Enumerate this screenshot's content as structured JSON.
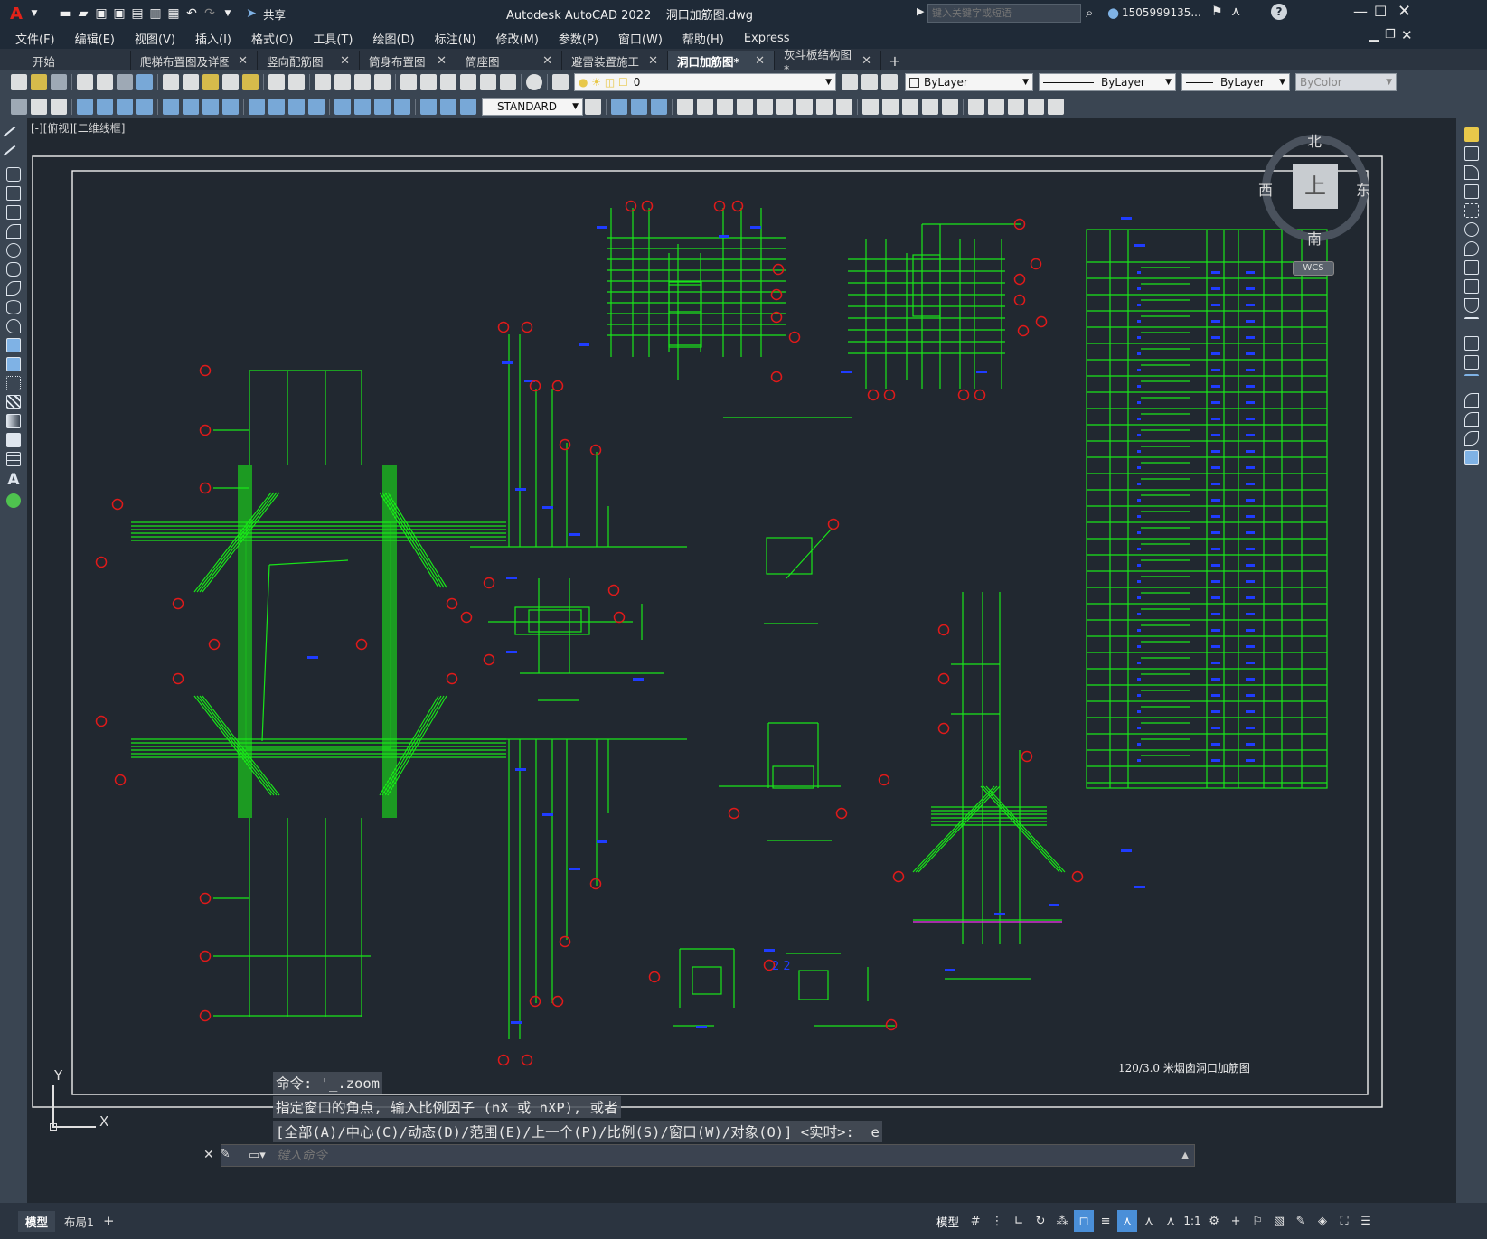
{
  "titlebar": {
    "app_logo": "A",
    "share_label": "共享",
    "title": "Autodesk AutoCAD 2022    洞口加筋图.dwg",
    "search_placeholder": "键入关键字或短语",
    "user": "1505999135...",
    "help": "?"
  },
  "menu": [
    "文件(F)",
    "编辑(E)",
    "视图(V)",
    "插入(I)",
    "格式(O)",
    "工具(T)",
    "绘图(D)",
    "标注(N)",
    "修改(M)",
    "参数(P)",
    "窗口(W)",
    "帮助(H)",
    "Express"
  ],
  "tabs": [
    {
      "label": "开始",
      "closable": false,
      "active": false
    },
    {
      "label": "爬梯布置图及详图一",
      "closable": true,
      "active": false
    },
    {
      "label": "竖向配筋图",
      "closable": true,
      "active": false
    },
    {
      "label": "筒身布置图",
      "closable": true,
      "active": false
    },
    {
      "label": "筒座图",
      "closable": true,
      "active": false
    },
    {
      "label": "避雷装置施工图",
      "closable": true,
      "active": false
    },
    {
      "label": "洞口加筋图*",
      "closable": true,
      "active": true
    },
    {
      "label": "灰斗板结构图*",
      "closable": true,
      "active": false
    }
  ],
  "toolbar": {
    "layer_value": "0",
    "color_value": "ByLayer",
    "linetype_value": "ByLayer",
    "lineweight_value": "ByLayer",
    "plotstyle_value": "ByColor",
    "textstyle_value": "STANDARD"
  },
  "viewport_label": "[-][俯视][二维线框]",
  "viewcube": {
    "north": "北",
    "south": "南",
    "east": "东",
    "west": "西",
    "top": "上",
    "wcs": "WCS"
  },
  "drawing": {
    "caption": "120/3.0 米烟囱洞口加筋图",
    "label_23": "2  2"
  },
  "ucs": {
    "x": "X",
    "y": "Y"
  },
  "command": {
    "history": [
      "命令: '_.zoom",
      "指定窗口的角点, 输入比例因子 (nX 或 nXP), 或者",
      "[全部(A)/中心(C)/动态(D)/范围(E)/上一个(P)/比例(S)/窗口(W)/对象(O)] <实时>: _e"
    ],
    "placeholder": "键入命令"
  },
  "layout_tabs": [
    "模型",
    "布局1"
  ],
  "status": {
    "model": "模型",
    "scale": "1:1"
  },
  "colors": {
    "line": "#19e619",
    "dim": "#1f3cff",
    "mark": "#e01a1a",
    "bg": "#212830"
  }
}
